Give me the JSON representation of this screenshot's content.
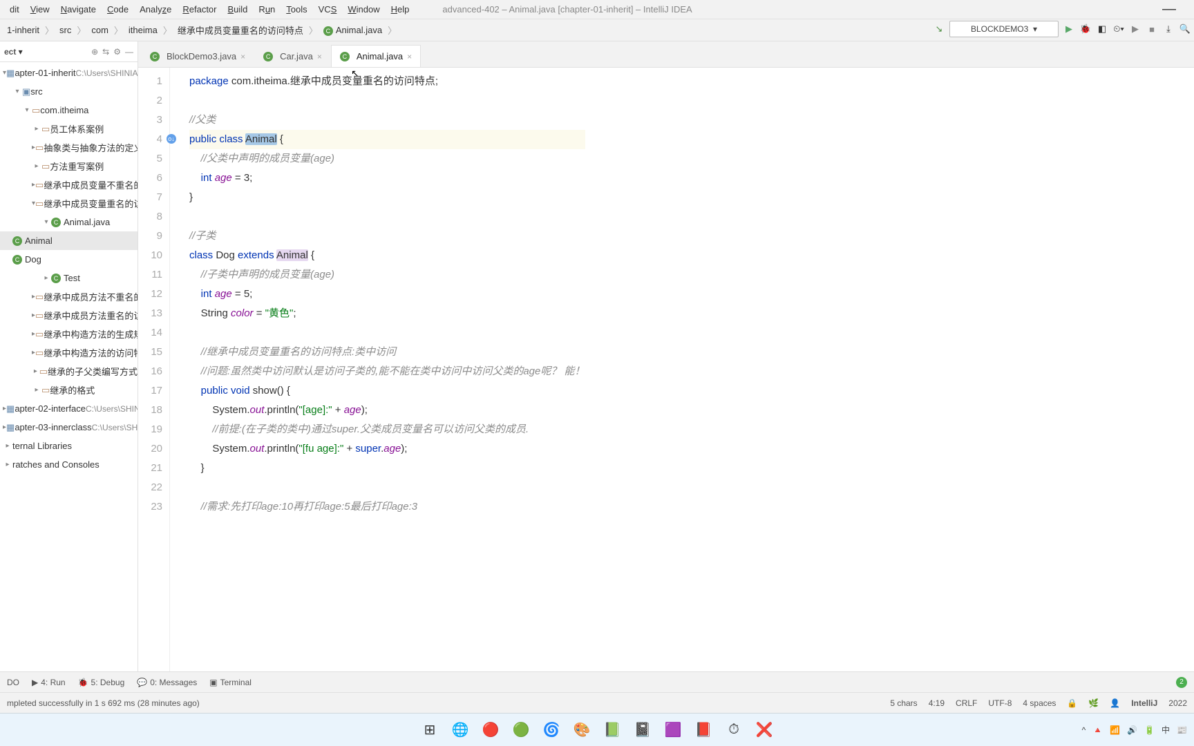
{
  "menu": {
    "items": [
      "dit",
      "View",
      "Navigate",
      "Code",
      "Analyze",
      "Refactor",
      "Build",
      "Run",
      "Tools",
      "VCS",
      "Window",
      "Help"
    ]
  },
  "window": {
    "title": "advanced-402 – Animal.java [chapter-01-inherit] – IntelliJ IDEA"
  },
  "breadcrumb": [
    "1-inherit",
    "src",
    "com",
    "itheima",
    "继承中成员变量重名的访问特点",
    "Animal.java"
  ],
  "run_config": "BLOCKDEMO3",
  "sidebar": {
    "header": "ect",
    "nodes": [
      {
        "label": "apter-01-inherit",
        "path": "C:\\Users\\SHINIAN",
        "depth": 0,
        "open": true,
        "kind": "mod"
      },
      {
        "label": "src",
        "depth": 1,
        "open": true,
        "kind": "folder"
      },
      {
        "label": "com.itheima",
        "depth": 2,
        "open": true,
        "kind": "pkg"
      },
      {
        "label": "员工体系案例",
        "depth": 3,
        "kind": "pkg"
      },
      {
        "label": "抽象类与抽象方法的定义",
        "depth": 3,
        "kind": "pkg"
      },
      {
        "label": "方法重写案例",
        "depth": 3,
        "kind": "pkg"
      },
      {
        "label": "继承中成员变量不重名的访问特",
        "depth": 3,
        "kind": "pkg"
      },
      {
        "label": "继承中成员变量重名的访问特点",
        "depth": 3,
        "open": true,
        "kind": "pkg"
      },
      {
        "label": "Animal.java",
        "depth": 4,
        "open": true,
        "kind": "file",
        "sel": false
      },
      {
        "label": "Animal",
        "depth": 5,
        "kind": "class",
        "sel": true
      },
      {
        "label": "Dog",
        "depth": 5,
        "kind": "class"
      },
      {
        "label": "Test",
        "depth": 4,
        "kind": "class"
      },
      {
        "label": "继承中成员方法不重名的访问特",
        "depth": 3,
        "kind": "pkg"
      },
      {
        "label": "继承中成员方法重名的访问特点",
        "depth": 3,
        "kind": "pkg"
      },
      {
        "label": "继承中构造方法的生成规范",
        "depth": 3,
        "kind": "pkg"
      },
      {
        "label": "继承中构造方法的访问特点",
        "depth": 3,
        "kind": "pkg"
      },
      {
        "label": "继承的子父类编写方式",
        "depth": 3,
        "kind": "pkg"
      },
      {
        "label": "继承的格式",
        "depth": 3,
        "kind": "pkg"
      },
      {
        "label": "apter-02-interface",
        "path": "C:\\Users\\SHIN",
        "depth": 0,
        "kind": "mod"
      },
      {
        "label": "apter-03-innerclass",
        "path": "C:\\Users\\SHIN",
        "depth": 0,
        "kind": "mod"
      },
      {
        "label": "ternal Libraries",
        "depth": 0,
        "kind": "lib"
      },
      {
        "label": "ratches and Consoles",
        "depth": 0,
        "kind": "scratch"
      }
    ]
  },
  "tabs": [
    {
      "label": "BlockDemo3.java",
      "active": false
    },
    {
      "label": "Car.java",
      "active": false
    },
    {
      "label": "Animal.java",
      "active": true
    }
  ],
  "code": {
    "lines": [
      {
        "n": 1,
        "segs": [
          {
            "t": "package ",
            "c": "kw"
          },
          {
            "t": "com.itheima.继承中成员变量重名的访问特点;"
          }
        ]
      },
      {
        "n": 2,
        "segs": []
      },
      {
        "n": 3,
        "segs": [
          {
            "t": "//父类",
            "c": "com"
          }
        ]
      },
      {
        "n": 4,
        "hl": true,
        "icon": "sub",
        "segs": [
          {
            "t": "public class ",
            "c": "kw"
          },
          {
            "t": "Animal",
            "c": "sel-word"
          },
          {
            "t": " {"
          }
        ]
      },
      {
        "n": 5,
        "segs": [
          {
            "t": "    "
          },
          {
            "t": "//父类中声明的成员变量(age)",
            "c": "com"
          }
        ]
      },
      {
        "n": 6,
        "segs": [
          {
            "t": "    "
          },
          {
            "t": "int ",
            "c": "kw"
          },
          {
            "t": "age",
            "c": "field"
          },
          {
            "t": " = 3;"
          }
        ]
      },
      {
        "n": 7,
        "segs": [
          {
            "t": "}"
          }
        ]
      },
      {
        "n": 8,
        "segs": []
      },
      {
        "n": 9,
        "segs": [
          {
            "t": "//子类",
            "c": "com"
          }
        ]
      },
      {
        "n": 10,
        "segs": [
          {
            "t": "class ",
            "c": "kw"
          },
          {
            "t": "Dog "
          },
          {
            "t": "extends ",
            "c": "kw"
          },
          {
            "t": "Animal",
            "c": "usage-word"
          },
          {
            "t": " {"
          }
        ]
      },
      {
        "n": 11,
        "segs": [
          {
            "t": "    "
          },
          {
            "t": "//子类中声明的成员变量(age)",
            "c": "com"
          }
        ]
      },
      {
        "n": 12,
        "segs": [
          {
            "t": "    "
          },
          {
            "t": "int ",
            "c": "kw"
          },
          {
            "t": "age",
            "c": "field"
          },
          {
            "t": " = 5;"
          }
        ]
      },
      {
        "n": 13,
        "segs": [
          {
            "t": "    String "
          },
          {
            "t": "color",
            "c": "field"
          },
          {
            "t": " = "
          },
          {
            "t": "\"黄色\"",
            "c": "str"
          },
          {
            "t": ";"
          }
        ]
      },
      {
        "n": 14,
        "segs": []
      },
      {
        "n": 15,
        "segs": [
          {
            "t": "    "
          },
          {
            "t": "//继承中成员变量重名的访问特点:类中访问",
            "c": "com"
          }
        ]
      },
      {
        "n": 16,
        "segs": [
          {
            "t": "    "
          },
          {
            "t": "//问题:虽然类中访问默认是访问子类的,能不能在类中访问中访问父类的age呢？ 能！",
            "c": "com"
          }
        ]
      },
      {
        "n": 17,
        "segs": [
          {
            "t": "    "
          },
          {
            "t": "public void ",
            "c": "kw"
          },
          {
            "t": "show"
          },
          {
            "t": "() {"
          }
        ]
      },
      {
        "n": 18,
        "segs": [
          {
            "t": "        System."
          },
          {
            "t": "out",
            "c": "field"
          },
          {
            "t": ".println("
          },
          {
            "t": "\"[age]:\"",
            "c": "str"
          },
          {
            "t": " + "
          },
          {
            "t": "age",
            "c": "field"
          },
          {
            "t": ");"
          }
        ]
      },
      {
        "n": 19,
        "segs": [
          {
            "t": "        "
          },
          {
            "t": "//前提:(在子类的类中)通过super.父类成员变量名可以访问父类的成员.",
            "c": "com"
          }
        ]
      },
      {
        "n": 20,
        "segs": [
          {
            "t": "        System."
          },
          {
            "t": "out",
            "c": "field"
          },
          {
            "t": ".println("
          },
          {
            "t": "\"[fu age]:\"",
            "c": "str"
          },
          {
            "t": " + "
          },
          {
            "t": "super",
            "c": "kw"
          },
          {
            "t": "."
          },
          {
            "t": "age",
            "c": "field"
          },
          {
            "t": ");"
          }
        ]
      },
      {
        "n": 21,
        "segs": [
          {
            "t": "    }"
          }
        ]
      },
      {
        "n": 22,
        "segs": []
      },
      {
        "n": 23,
        "segs": [
          {
            "t": "    "
          },
          {
            "t": "//需求:先打印age:10再打印age:5最后打印age:3",
            "c": "com"
          }
        ]
      }
    ]
  },
  "tool_strip": {
    "items": [
      "DO",
      "4: Run",
      "5: Debug",
      "0: Messages",
      "Terminal"
    ],
    "badge": "2"
  },
  "status": {
    "left": "mpleted successfully in 1 s 692 ms (28 minutes ago)",
    "chars": "5 chars",
    "pos": "4:19",
    "eol": "CRLF",
    "enc": "UTF-8",
    "indent": "4 spaces",
    "brand": "IntelliJ",
    "year": "2022"
  },
  "taskbar": {
    "items": [
      "⊞",
      "🌐",
      "🔴",
      "🟢",
      "🌀",
      "🎨",
      "📗",
      "📓",
      "🟪",
      "📕",
      "⏱",
      "❌"
    ],
    "tray": [
      "^",
      "🔺",
      "📶",
      "🔊",
      "🔋",
      "中",
      "📰"
    ]
  }
}
